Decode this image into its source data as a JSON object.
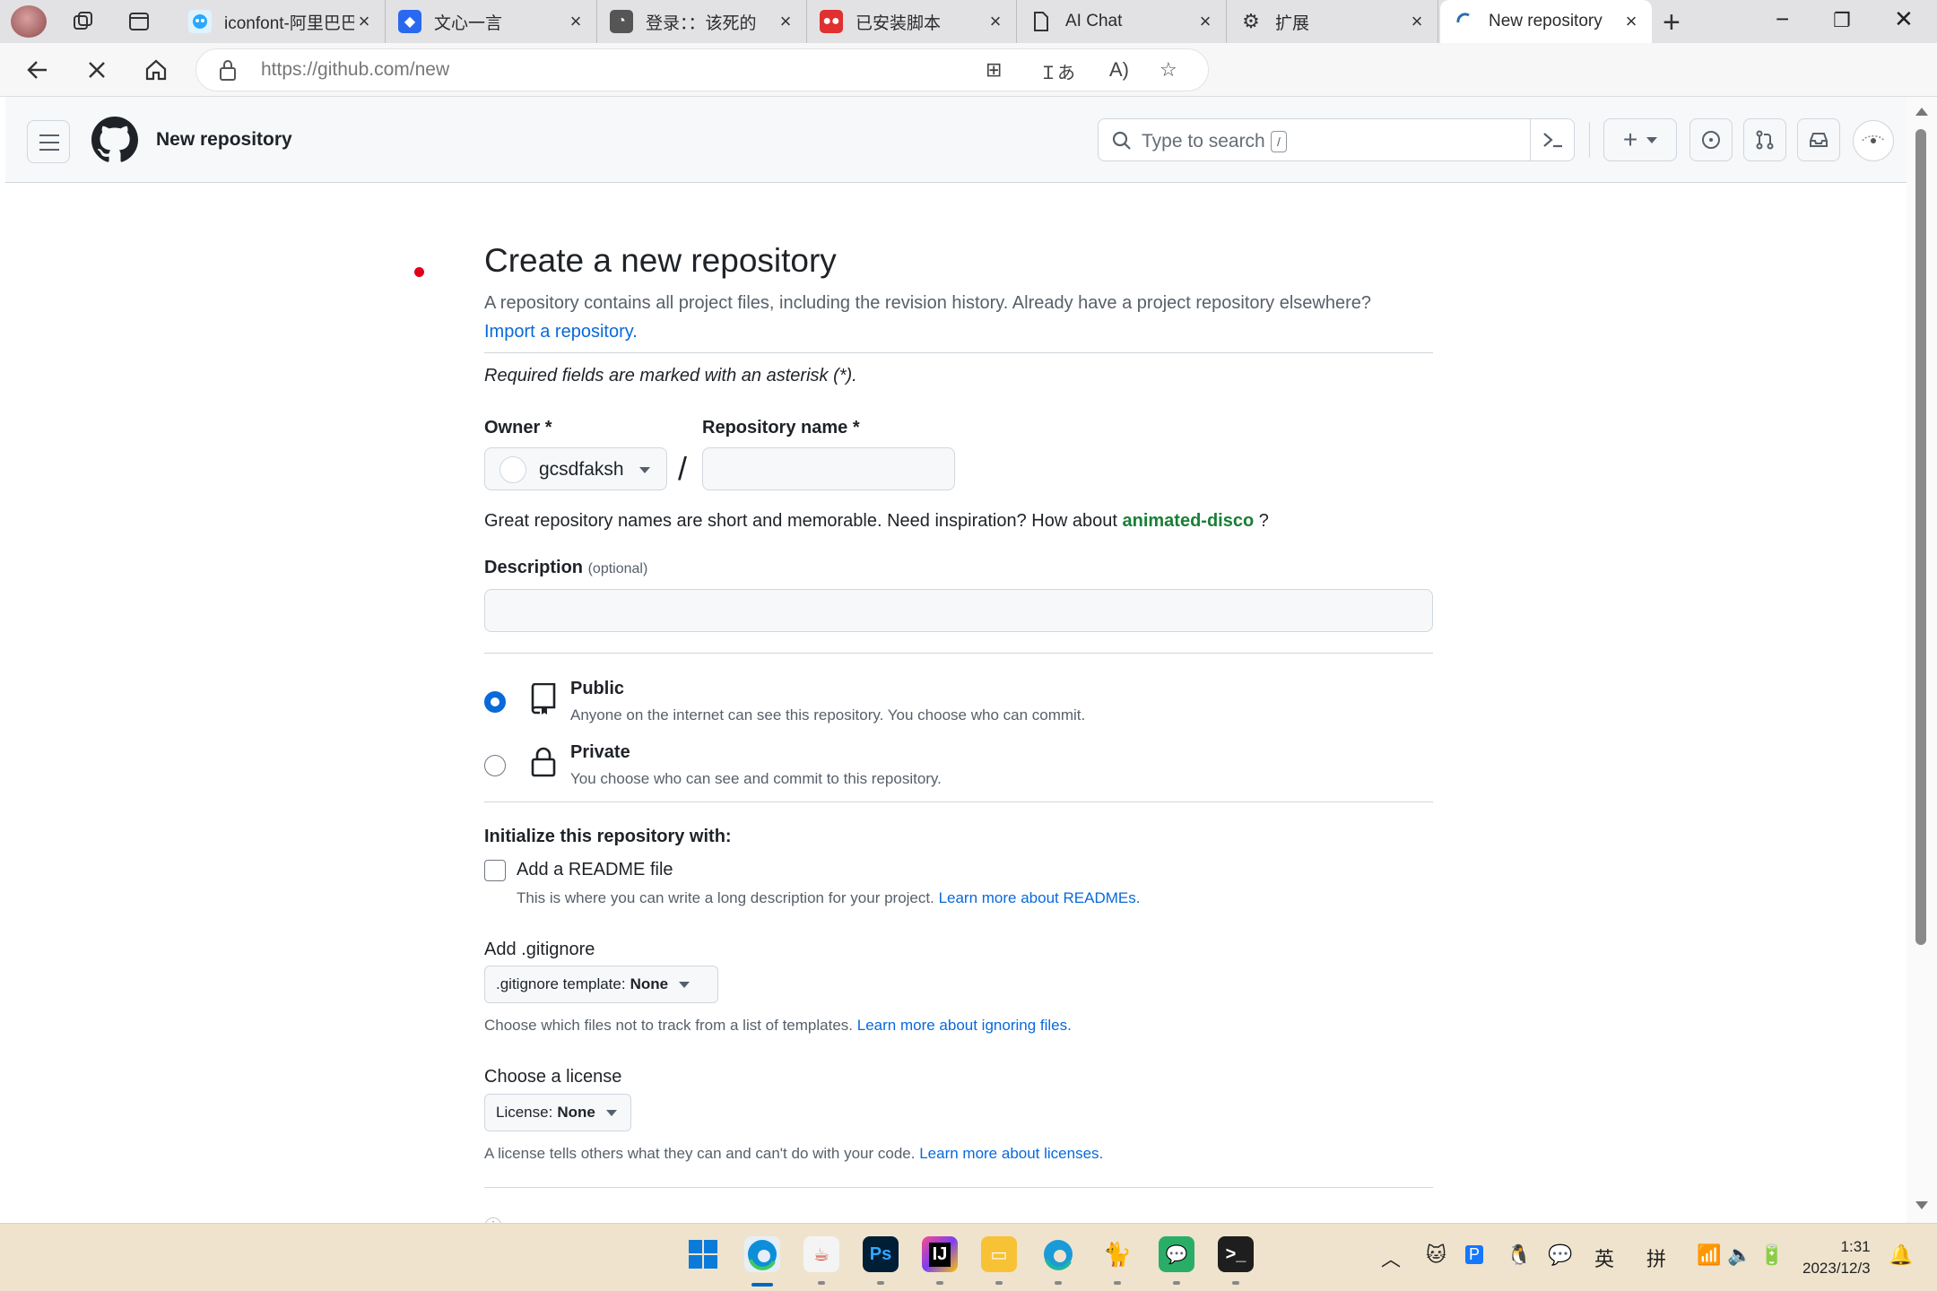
{
  "browser": {
    "tabs": [
      {
        "title": "iconfont-阿里巴巴矢量图标库",
        "favicon_color": "#2aa7ff"
      },
      {
        "title": "文心一言",
        "favicon_color": "#2a68f0"
      },
      {
        "title": "登录：：该死的",
        "favicon_color": "#555555"
      },
      {
        "title": "已安装脚本",
        "favicon_color": "#e03030"
      },
      {
        "title": "AI Chat",
        "favicon_color": "#ffffff"
      },
      {
        "title": "扩展",
        "favicon_color": "#ffffff"
      },
      {
        "title": "New repository",
        "favicon_color": "#2b6cb0"
      }
    ],
    "url_host": "https://github.com",
    "url_path": "/new"
  },
  "gh_header": {
    "context": "New repository",
    "search_placeholder": "Type to search",
    "search_shortcut": "/"
  },
  "form": {
    "title": "Create a new repository",
    "lead": "A repository contains all project files, including the revision history. Already have a project repository elsewhere?",
    "import_link": "Import a repository.",
    "required_note": "Required fields are marked with an asterisk (*).",
    "owner_label": "Owner *",
    "owner_name": "gcsdfaksh",
    "repo_label": "Repository name *",
    "repo_value": "",
    "name_hint_prefix": "Great repository names are short and memorable. Need inspiration? How about",
    "name_suggestion": "animated-disco",
    "name_hint_suffix": "?",
    "description_label": "Description",
    "description_optional": "(optional)",
    "description_value": "",
    "visibility": {
      "selected": "public",
      "public_title": "Public",
      "public_desc": "Anyone on the internet can see this repository. You choose who can commit.",
      "private_title": "Private",
      "private_desc": "You choose who can see and commit to this repository."
    },
    "init_heading": "Initialize this repository with:",
    "readme_label": "Add a README file",
    "readme_checked": false,
    "readme_desc": "This is where you can write a long description for your project.",
    "readme_link": "Learn more about READMEs.",
    "gitignore_heading": "Add .gitignore",
    "gitignore_prefix": ".gitignore template:",
    "gitignore_value": "None",
    "gitignore_desc": "Choose which files not to track from a list of templates.",
    "gitignore_link": "Learn more about ignoring files.",
    "license_heading": "Choose a license",
    "license_prefix": "License:",
    "license_value": "None",
    "license_desc": "A license tells others what they can and can't do with your code.",
    "license_link": "Learn more about licenses."
  },
  "taskbar": {
    "time": "1:31",
    "date": "2023/12/3",
    "ime_lang": "英",
    "ime_mode": "拼"
  }
}
